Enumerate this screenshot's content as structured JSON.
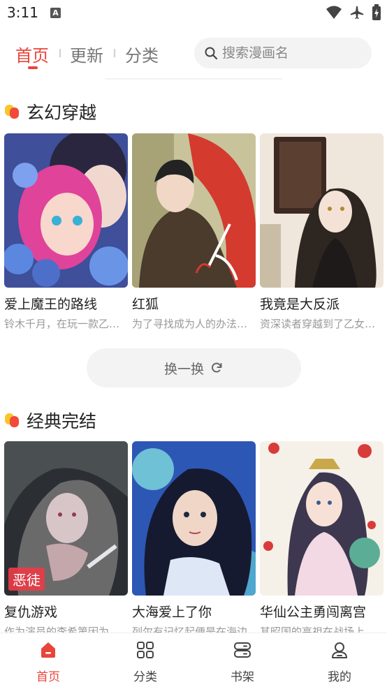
{
  "status_bar": {
    "time": "3:11",
    "notification_badge": "A"
  },
  "top_nav": {
    "tabs": [
      {
        "label": "首页",
        "active": true
      },
      {
        "label": "更新",
        "active": false
      },
      {
        "label": "分类",
        "active": false
      }
    ],
    "search": {
      "placeholder": "搜索漫画名",
      "value": ""
    }
  },
  "sections": [
    {
      "title": "玄幻穿越",
      "items": [
        {
          "title": "爱上魔王的路线",
          "desc": "铃木千月，在玩一款乙女游戏时穿越了"
        },
        {
          "title": "红狐",
          "desc": "为了寻找成为人的办法而来到人间"
        },
        {
          "title": "我竟是大反派",
          "desc": "资深读者穿越到了乙女小说中"
        }
      ],
      "swap_button": {
        "label": "换一换"
      }
    },
    {
      "title": "经典完结",
      "items": [
        {
          "title": "复仇游戏",
          "desc": "作为演员的李希第因为",
          "badge": "恶徒"
        },
        {
          "title": "大海爱上了你",
          "desc": "列尔有记忆起便是在海边"
        },
        {
          "title": "华仙公主勇闯离宫",
          "desc": "其昭国的高祖在战场上"
        }
      ]
    }
  ],
  "bottom_nav": {
    "items": [
      {
        "label": "首页",
        "icon": "home-icon",
        "active": true
      },
      {
        "label": "分类",
        "icon": "grid-icon",
        "active": false
      },
      {
        "label": "书架",
        "icon": "bookshelf-icon",
        "active": false
      },
      {
        "label": "我的",
        "icon": "profile-icon",
        "active": false
      }
    ]
  },
  "colors": {
    "accent": "#e8453a",
    "section_icon_yellow": "#f8c52a",
    "section_icon_red": "#f24a3a"
  }
}
